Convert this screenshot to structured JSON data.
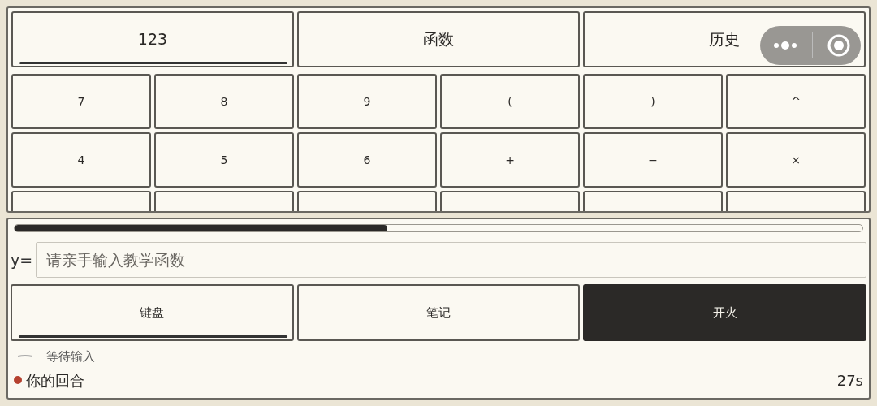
{
  "tabs": [
    {
      "label": "123",
      "selected": true
    },
    {
      "label": "函数",
      "selected": false
    },
    {
      "label": "历史",
      "selected": false
    }
  ],
  "keypad": {
    "rows": [
      [
        "7",
        "8",
        "9",
        "(",
        ")",
        "^"
      ],
      [
        "4",
        "5",
        "6",
        "+",
        "−",
        "×"
      ]
    ],
    "cut_row": [
      {
        "kind": "key"
      },
      {
        "kind": "key"
      },
      {
        "kind": "key"
      },
      {
        "kind": "key"
      },
      {
        "kind": "key"
      },
      {
        "kind": "key"
      }
    ]
  },
  "progress": {
    "level": 0.44
  },
  "formula": {
    "prefix": "y=",
    "placeholder": "请亲手输入教学函数"
  },
  "actions": [
    {
      "label": "键盘",
      "kind": "toggle",
      "selected": true
    },
    {
      "label": "笔记",
      "kind": "toggle",
      "selected": false
    },
    {
      "label": "开火",
      "kind": "primary"
    }
  ],
  "status": {
    "text": "等待输入"
  },
  "turn": {
    "text": "你的回合",
    "color": "#b5412f",
    "timer": "27s"
  }
}
